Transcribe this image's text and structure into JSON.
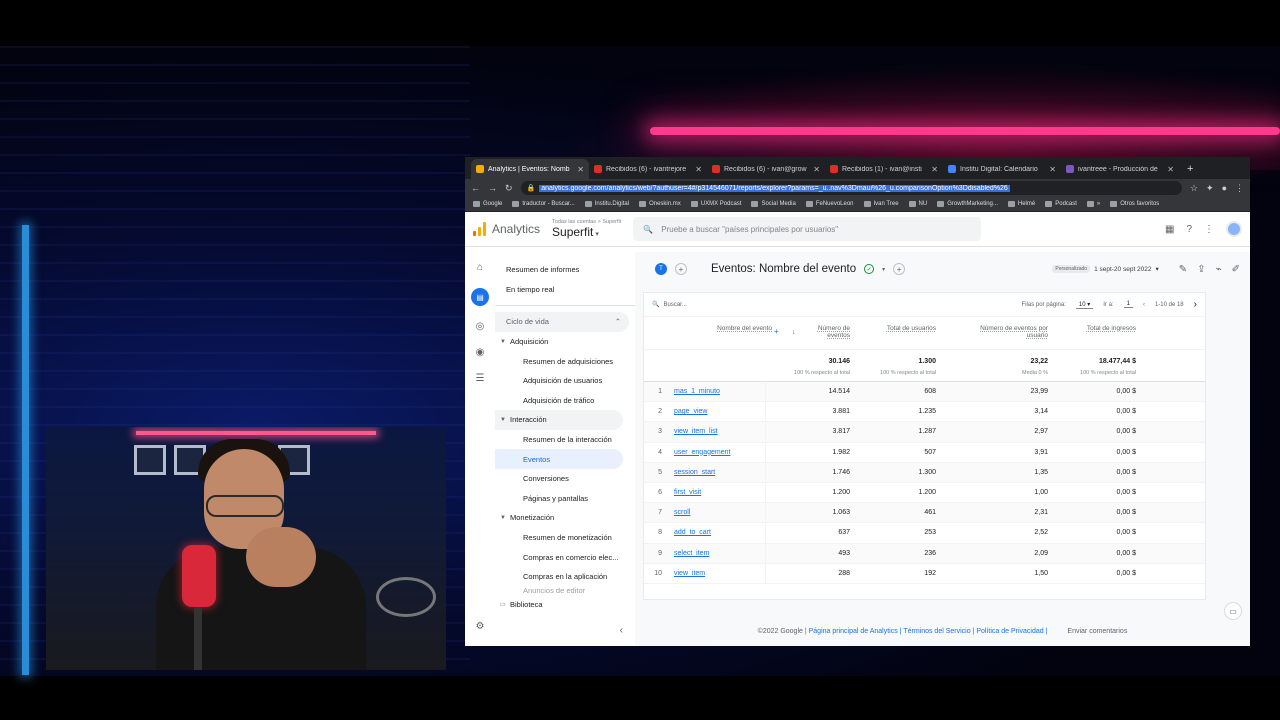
{
  "browser": {
    "tabs": [
      {
        "label": "Analytics | Eventos: Nomb",
        "color": "#f9ab00",
        "active": true
      },
      {
        "label": "Recibidos (6) - ivantrejore",
        "color": "#d93025"
      },
      {
        "label": "Recibidos (6) - ivan@grow",
        "color": "#d93025"
      },
      {
        "label": "Recibidos (1) - ivan@insti",
        "color": "#d93025"
      },
      {
        "label": "Institu Digital: Calendario",
        "color": "#4285f4"
      },
      {
        "label": "ivantreee - Producción de",
        "color": "#7e57c2"
      }
    ],
    "url": "analytics.google.com/analytics/web/?authuser=4#/p314546071/reports/explorer?params=_u..nav%3Dmaui%26_u.comparisonOption%3Ddisabled%26",
    "bookmarks": [
      "Google",
      "traductor - Buscar...",
      "Institu.Digital",
      "Oneskin.mx",
      "UXMX Podcast",
      "Social Media",
      "FeNuevoLeon",
      "Ivan Tree",
      "NU",
      "GrowthMarketing...",
      "Helmé",
      "Podcast",
      "»",
      "Otros favoritos"
    ]
  },
  "ga": {
    "product": "Analytics",
    "account_path": "Todas las cuentas > Superfit",
    "property": "Superfit",
    "search_placeholder": "Pruebe a buscar \"países principales por usuarios\"",
    "logo_colors": [
      "#f9ab00",
      "#e37400"
    ],
    "accent": "#1a73e8"
  },
  "sidenav": {
    "top": [
      "Resumen de informes",
      "En tiempo real"
    ],
    "section": "Ciclo de vida",
    "groups": [
      {
        "label": "Adquisición",
        "items": [
          "Resumen de adquisiciones",
          "Adquisición de usuarios",
          "Adquisición de tráfico"
        ]
      },
      {
        "label": "Interacción",
        "items": [
          "Resumen de la interacción",
          "Eventos",
          "Conversiones",
          "Páginas y pantallas"
        ]
      },
      {
        "label": "Monetización",
        "items": [
          "Resumen de monetización",
          "Compras en comercio elec...",
          "Compras en la aplicación",
          "Anuncios de editor"
        ]
      }
    ],
    "library": "Biblioteca",
    "active_item": "Eventos"
  },
  "report": {
    "badge": "T",
    "title": "Eventos: Nombre del evento",
    "date_label": "Personalizado",
    "date_range": "1 sept-20 sept 2022"
  },
  "table": {
    "search_placeholder": "Buscar...",
    "rows_per_page_label": "Filas por página:",
    "rows_per_page": "10",
    "goto_label": "Ir a:",
    "goto_value": "1",
    "pagination": "1-10 de 18",
    "headers": [
      "Nombre del evento",
      "Número de eventos",
      "Total de usuarios",
      "Número de eventos por usuario",
      "Total de ingresos"
    ],
    "totals": [
      "30.146",
      "1.300",
      "23,22",
      "18.477,44 $"
    ],
    "totals_sub": [
      "100 % respecto al total",
      "100 % respecto al total",
      "Media 0 %",
      "100 % respecto al total"
    ],
    "rows": [
      {
        "n": "1",
        "name": "mas_1_minuto",
        "events": "14.514",
        "users": "608",
        "per_user": "23,99",
        "revenue": "0,00 $"
      },
      {
        "n": "2",
        "name": "page_view",
        "events": "3.881",
        "users": "1.235",
        "per_user": "3,14",
        "revenue": "0,00 $"
      },
      {
        "n": "3",
        "name": "view_item_list",
        "events": "3.817",
        "users": "1.287",
        "per_user": "2,97",
        "revenue": "0,00 $"
      },
      {
        "n": "4",
        "name": "user_engagement",
        "events": "1.982",
        "users": "507",
        "per_user": "3,91",
        "revenue": "0,00 $"
      },
      {
        "n": "5",
        "name": "session_start",
        "events": "1.746",
        "users": "1.300",
        "per_user": "1,35",
        "revenue": "0,00 $"
      },
      {
        "n": "6",
        "name": "first_visit",
        "events": "1.200",
        "users": "1.200",
        "per_user": "1,00",
        "revenue": "0,00 $"
      },
      {
        "n": "7",
        "name": "scroll",
        "events": "1.063",
        "users": "461",
        "per_user": "2,31",
        "revenue": "0,00 $"
      },
      {
        "n": "8",
        "name": "add_to_cart",
        "events": "637",
        "users": "253",
        "per_user": "2,52",
        "revenue": "0,00 $"
      },
      {
        "n": "9",
        "name": "select_item",
        "events": "493",
        "users": "236",
        "per_user": "2,09",
        "revenue": "0,00 $"
      },
      {
        "n": "10",
        "name": "view_item",
        "events": "288",
        "users": "192",
        "per_user": "1,50",
        "revenue": "0,00 $"
      }
    ]
  },
  "footer": {
    "copyright": "©2022 Google",
    "links": "Página principal de Analytics | Términos del Servicio | Política de Privacidad |",
    "feedback": "Enviar comentarios"
  }
}
